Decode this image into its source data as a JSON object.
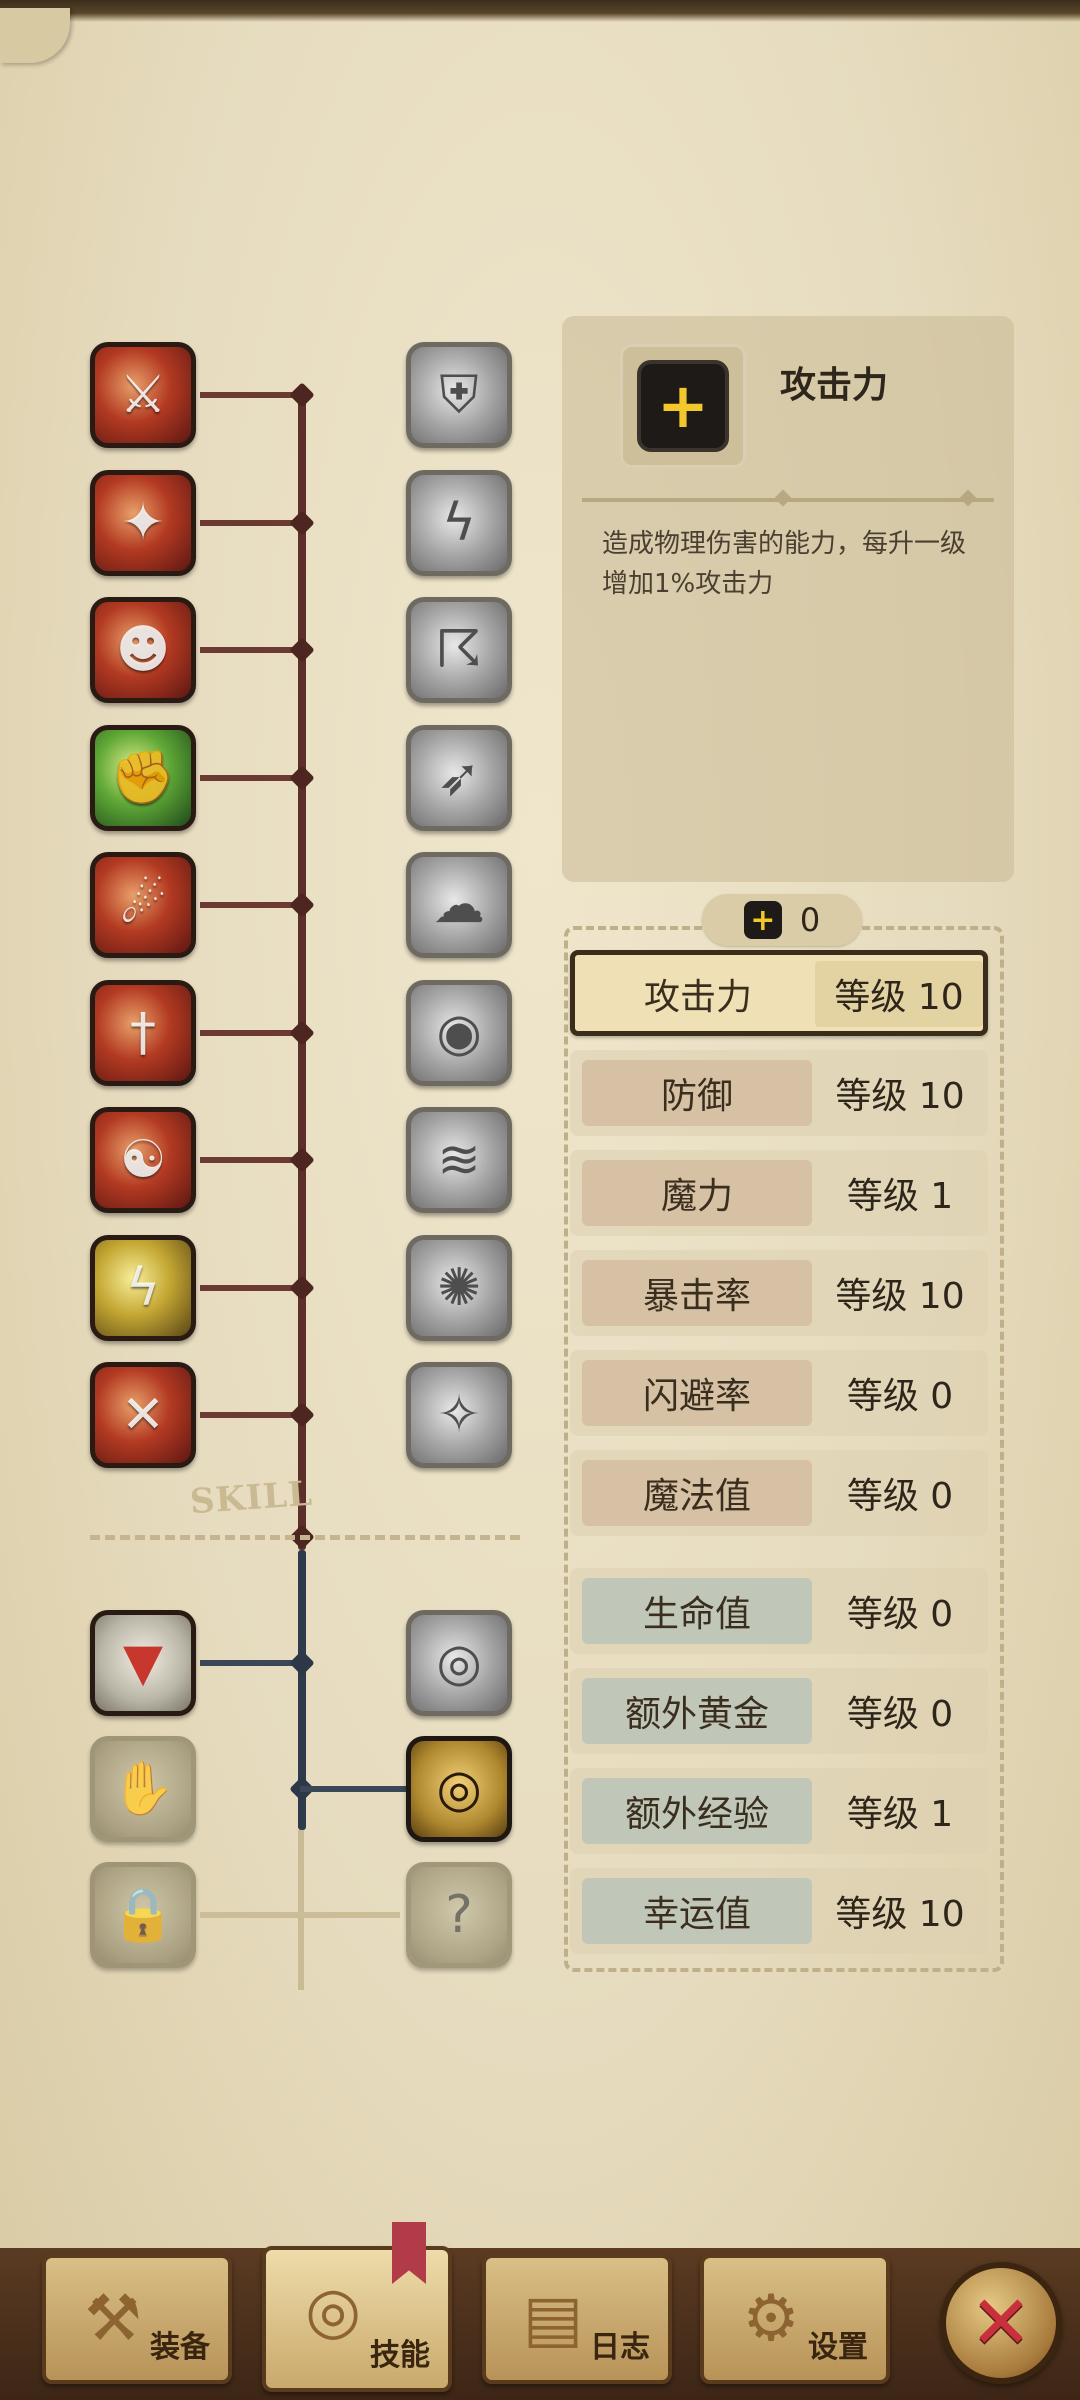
{
  "skill_tree": {
    "watermark": "SKILL",
    "left_column": [
      {
        "icon": "blade-slash-icon",
        "color": "red"
      },
      {
        "icon": "burning-runner-icon",
        "color": "red"
      },
      {
        "icon": "roaring-face-icon",
        "color": "red"
      },
      {
        "icon": "flexing-arm-icon",
        "color": "green"
      },
      {
        "icon": "shadow-strike-icon",
        "color": "red"
      },
      {
        "icon": "dagger-icon",
        "color": "red"
      },
      {
        "icon": "ninja-icon",
        "color": "red"
      },
      {
        "icon": "lightning-totem-icon",
        "color": "yellow"
      },
      {
        "icon": "crossed-swords-icon",
        "color": "red"
      }
    ],
    "right_column": [
      {
        "icon": "shield-icon",
        "color": "grey"
      },
      {
        "icon": "lightning-figure-icon",
        "color": "grey"
      },
      {
        "icon": "storm-icon",
        "color": "grey"
      },
      {
        "icon": "dash-figure-icon",
        "color": "grey"
      },
      {
        "icon": "smoke-figure-icon",
        "color": "grey"
      },
      {
        "icon": "eye-burst-icon",
        "color": "grey"
      },
      {
        "icon": "wave-icon",
        "color": "grey"
      },
      {
        "icon": "orb-icon",
        "color": "grey"
      },
      {
        "icon": "sparkle-spirit-icon",
        "color": "grey"
      }
    ],
    "lower_left": [
      {
        "icon": "treasure-chest-down-icon",
        "state": "unlocked"
      },
      {
        "icon": "treasure-hand-icon",
        "state": "locked"
      },
      {
        "icon": "lock-icon",
        "state": "locked"
      }
    ],
    "lower_right": [
      {
        "icon": "eye-chest-icon",
        "state": "inactive"
      },
      {
        "icon": "eye-chest-icon",
        "state": "active"
      },
      {
        "icon": "lock-question-icon",
        "state": "locked"
      }
    ]
  },
  "info": {
    "icon": "plus-icon",
    "title": "攻击力",
    "description": "造成物理伤害的能力，每升一级增加1%攻击力"
  },
  "points": {
    "icon": "plus-icon",
    "value": "0"
  },
  "stats": [
    {
      "name": "攻击力",
      "level": "等级 10",
      "group": "pink",
      "selected": true
    },
    {
      "name": "防御",
      "level": "等级 10",
      "group": "pink",
      "selected": false
    },
    {
      "name": "魔力",
      "level": "等级 1",
      "group": "pink",
      "selected": false
    },
    {
      "name": "暴击率",
      "level": "等级 10",
      "group": "pink",
      "selected": false
    },
    {
      "name": "闪避率",
      "level": "等级 0",
      "group": "pink",
      "selected": false
    },
    {
      "name": "魔法值",
      "level": "等级 0",
      "group": "pink",
      "selected": false
    },
    {
      "name": "生命值",
      "level": "等级 0",
      "group": "blue",
      "selected": false
    },
    {
      "name": "额外黄金",
      "level": "等级 0",
      "group": "blue",
      "selected": false
    },
    {
      "name": "额外经验",
      "level": "等级 1",
      "group": "blue",
      "selected": false
    },
    {
      "name": "幸运值",
      "level": "等级 10",
      "group": "blue",
      "selected": false
    }
  ],
  "tabs": [
    {
      "label": "装备",
      "icon": "axe-icon",
      "selected": false
    },
    {
      "label": "技能",
      "icon": "skill-swirl-icon",
      "selected": true
    },
    {
      "label": "日志",
      "icon": "journal-icon",
      "selected": false
    },
    {
      "label": "设置",
      "icon": "gear-icon",
      "selected": false
    }
  ],
  "close": {
    "icon": "close-icon"
  },
  "colors": {
    "accent_yellow": "#f3c82a",
    "tree_red": "#5c2f2a",
    "tree_blue": "#2f3a4a",
    "close_red": "#c8303b"
  }
}
